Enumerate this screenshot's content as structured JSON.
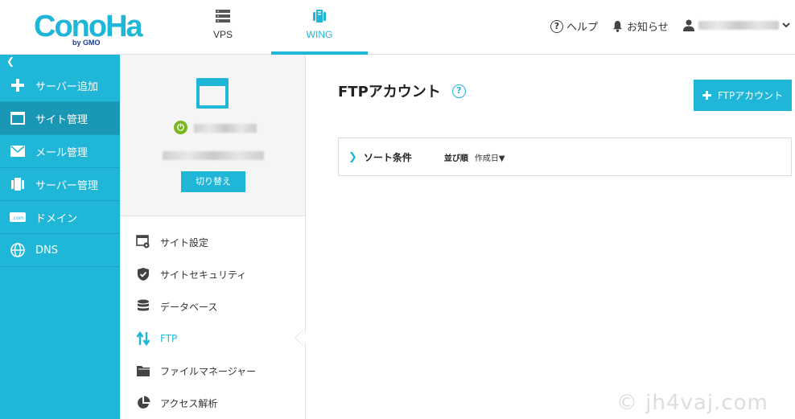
{
  "header": {
    "logo_text": "ConoHa",
    "logo_sub": "by GMO",
    "tabs": [
      {
        "label": "VPS",
        "icon": "server-icon"
      },
      {
        "label": "WING",
        "icon": "wing-icon"
      }
    ],
    "help_label": "ヘルプ",
    "notice_label": "お知らせ"
  },
  "sidebar": {
    "collapse_glyph": "❮",
    "items": [
      {
        "label": "サーバー追加",
        "icon": "plus-icon"
      },
      {
        "label": "サイト管理",
        "icon": "window-icon"
      },
      {
        "label": "メール管理",
        "icon": "mail-icon"
      },
      {
        "label": "サーバー管理",
        "icon": "server-manage-icon"
      },
      {
        "label": "ドメイン",
        "icon": "domain-icon"
      },
      {
        "label": "DNS",
        "icon": "globe-icon"
      }
    ]
  },
  "site_panel": {
    "switch_label": "切り替え",
    "menu": [
      {
        "label": "サイト設定",
        "icon": "site-settings-icon"
      },
      {
        "label": "サイトセキュリティ",
        "icon": "shield-icon"
      },
      {
        "label": "データベース",
        "icon": "database-icon"
      },
      {
        "label": "FTP",
        "icon": "ftp-icon"
      },
      {
        "label": "ファイルマネージャー",
        "icon": "folder-icon"
      },
      {
        "label": "アクセス解析",
        "icon": "pie-chart-icon"
      }
    ]
  },
  "main": {
    "title": "FTPアカウント",
    "help_glyph": "?",
    "add_button_label": "FTPアカウント",
    "sort": {
      "label": "ソート条件",
      "order_label": "並び順",
      "order_value": "作成日▼"
    }
  },
  "watermark": "© jh4vaj.com",
  "colors": {
    "accent": "#1fb6d8",
    "sidebar_active": "#1a97b5",
    "power_green": "#78b81c"
  }
}
